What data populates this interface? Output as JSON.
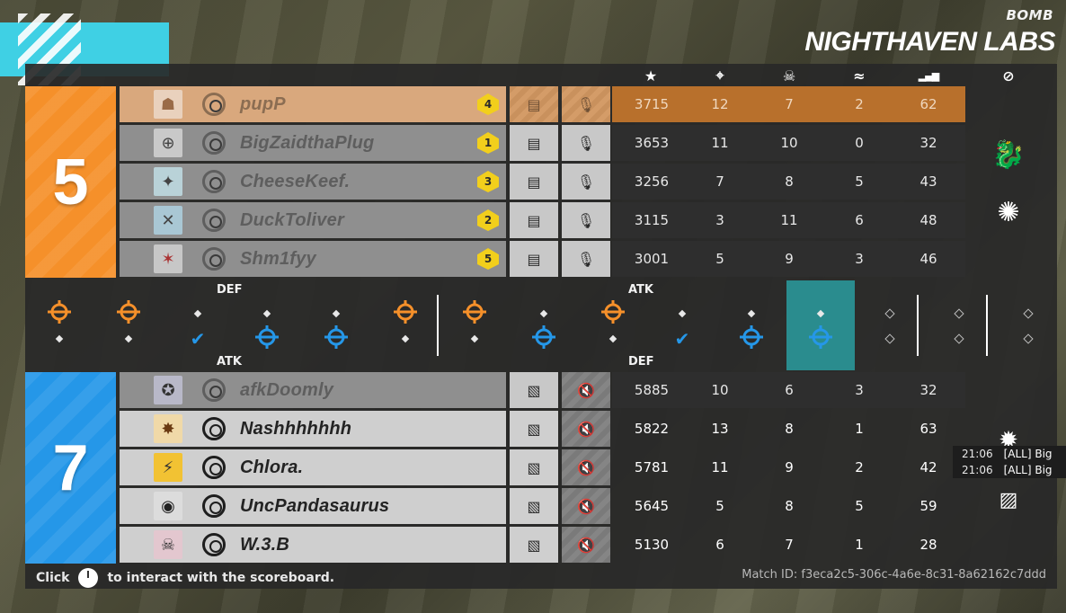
{
  "header": {
    "mode": "BOMB",
    "map": "NIGHTHAVEN LABS"
  },
  "columns": [
    {
      "icon": "star-icon",
      "glyph": "★"
    },
    {
      "icon": "kills-crosshair-icon",
      "glyph": "⌖"
    },
    {
      "icon": "deaths-skull-icon",
      "glyph": "☠"
    },
    {
      "icon": "assists-icon",
      "glyph": "≈"
    },
    {
      "icon": "ping-bars-icon",
      "glyph": "▂▄▆"
    },
    {
      "icon": "banned-icon",
      "glyph": "⊘"
    }
  ],
  "teams": {
    "orange": {
      "score": "5",
      "color": "#f5902a",
      "players": [
        {
          "name": "pupP",
          "rank": "4",
          "op_glyph": "☗",
          "stats": [
            "3715",
            "12",
            "7",
            "2",
            "62"
          ]
        },
        {
          "name": "BigZaidthaPlug",
          "rank": "1",
          "op_glyph": "⊕",
          "stats": [
            "3653",
            "11",
            "10",
            "0",
            "32"
          ]
        },
        {
          "name": "CheeseKeef.",
          "rank": "3",
          "op_glyph": "✦",
          "stats": [
            "3256",
            "7",
            "8",
            "5",
            "43"
          ]
        },
        {
          "name": "DuckToliver",
          "rank": "2",
          "op_glyph": "✕",
          "stats": [
            "3115",
            "3",
            "11",
            "6",
            "48"
          ]
        },
        {
          "name": "Shm1fyy",
          "rank": "5",
          "op_glyph": "✶",
          "stats": [
            "3001",
            "5",
            "9",
            "3",
            "46"
          ]
        }
      ]
    },
    "blue": {
      "score": "7",
      "color": "#2597e8",
      "players": [
        {
          "name": "afkDoomly",
          "op_glyph": "✪",
          "stats": [
            "5885",
            "10",
            "6",
            "3",
            "32"
          ]
        },
        {
          "name": "Nashhhhhhh",
          "op_glyph": "✸",
          "stats": [
            "5822",
            "13",
            "8",
            "1",
            "63"
          ]
        },
        {
          "name": "Chlora.",
          "op_glyph": "⚡",
          "stats": [
            "5781",
            "11",
            "9",
            "2",
            "42"
          ]
        },
        {
          "name": "UncPandasaurus",
          "op_glyph": "◉",
          "stats": [
            "5645",
            "5",
            "8",
            "5",
            "59"
          ]
        },
        {
          "name": "W.3.B",
          "op_glyph": "☠",
          "stats": [
            "5130",
            "6",
            "7",
            "1",
            "28"
          ]
        }
      ]
    }
  },
  "rounds": {
    "labels": {
      "orange_first": "DEF",
      "orange_second": "ATK",
      "blue_first": "ATK",
      "blue_second": "DEF"
    },
    "list": [
      {
        "top": "crosshair-orange",
        "bot": "dot"
      },
      {
        "top": "crosshair-orange",
        "bot": "dot"
      },
      {
        "top": "dot",
        "bot": "check-blue"
      },
      {
        "top": "dot",
        "bot": "crosshair-blue"
      },
      {
        "top": "dot",
        "bot": "crosshair-blue"
      },
      {
        "top": "crosshair-orange",
        "bot": "dot"
      },
      {
        "top": "crosshair-orange",
        "bot": "dot"
      },
      {
        "top": "dot",
        "bot": "crosshair-blue"
      },
      {
        "top": "crosshair-orange",
        "bot": "dot"
      },
      {
        "top": "dot",
        "bot": "check-blue"
      },
      {
        "top": "dot",
        "bot": "crosshair-blue"
      },
      {
        "top": "dot-current",
        "bot": "crosshair-blue-current"
      },
      {
        "top": "hollow",
        "bot": "hollow"
      },
      {
        "top": "hollow",
        "bot": "hollow"
      },
      {
        "top": "hollow",
        "bot": "hollow"
      }
    ]
  },
  "killfeed": [
    {
      "time": "21:06",
      "msg": "[ALL] Big"
    },
    {
      "time": "21:06",
      "msg": "[ALL] Big"
    }
  ],
  "footer": {
    "hint_before": "Click",
    "hint_after": "to interact with the scoreboard.",
    "match_id": "Match ID: f3eca2c5-306c-4a6e-8c31-8a62162c7ddd"
  }
}
